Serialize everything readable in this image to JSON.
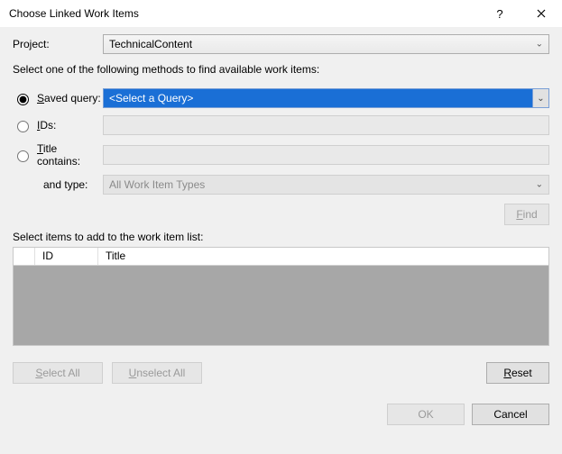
{
  "titlebar": {
    "title": "Choose Linked Work Items"
  },
  "project": {
    "label": "Project:",
    "value": "TechnicalContent"
  },
  "instruction": "Select one of the following methods to find available work items:",
  "methods": {
    "saved_query": {
      "label": "Saved query:",
      "value": "<Select a Query>",
      "selected": true
    },
    "ids": {
      "label": "IDs:",
      "value": ""
    },
    "title_contains": {
      "label": "Title contains:",
      "value": ""
    },
    "and_type": {
      "label": "and type:",
      "value": "All Work Item Types"
    }
  },
  "find_label": "Find",
  "grid": {
    "heading": "Select items to add to the work item list:",
    "columns": {
      "id": "ID",
      "title": "Title"
    }
  },
  "buttons": {
    "select_all": "Select All",
    "unselect_all": "Unselect All",
    "reset": "Reset",
    "ok": "OK",
    "cancel": "Cancel"
  }
}
